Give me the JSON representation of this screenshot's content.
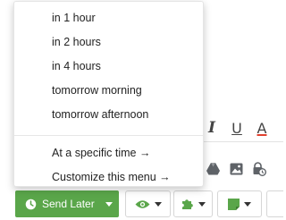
{
  "background": {
    "truncated_header_text": "~~~~~~~ ~~~ ~~~~~~~~~ ~~~~ ~~",
    "format_bar": {
      "italic": "I",
      "underline": "U",
      "text_color": "A"
    }
  },
  "schedule_menu": {
    "quick_options": [
      {
        "label": "in 1 hour"
      },
      {
        "label": "in 2 hours"
      },
      {
        "label": "in 4 hours"
      },
      {
        "label": "tomorrow morning"
      },
      {
        "label": "tomorrow afternoon"
      }
    ],
    "specific_time_label": "At a specific time →",
    "customize_label": "Customize this menu →"
  },
  "toolbar": {
    "send_later_label": "Send Later",
    "send_later_color": "#5aa64a",
    "eye_icon_color": "#5aa64a",
    "puzzle_icon_color": "#5aa64a",
    "note_icon_color": "#5aa64a"
  }
}
